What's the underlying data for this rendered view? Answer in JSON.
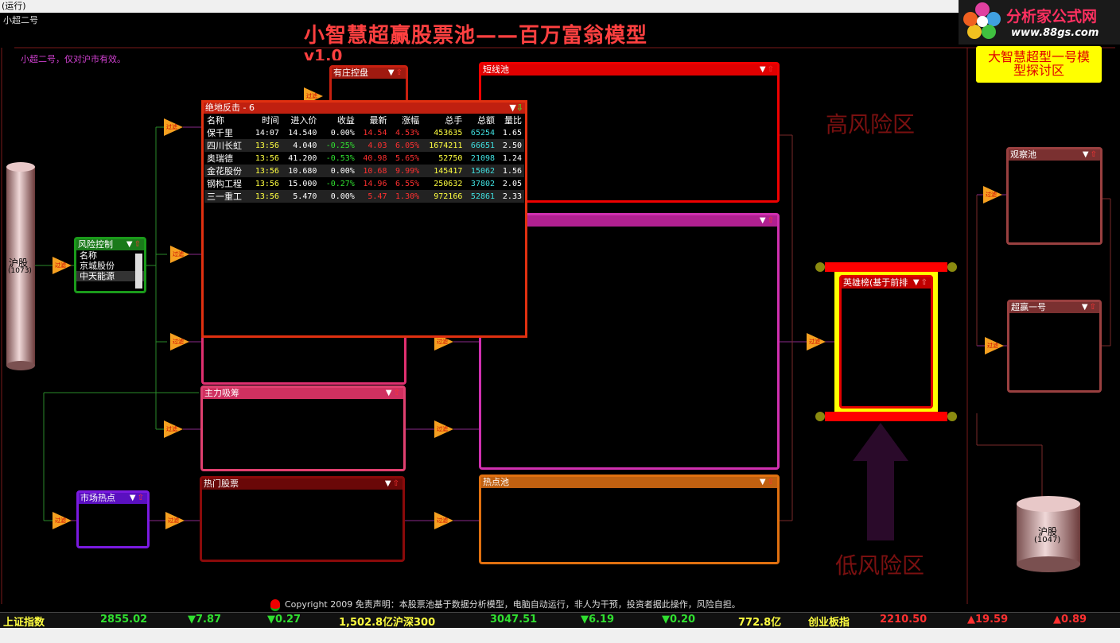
{
  "window": {
    "status": "(运行)",
    "subtitle": "小超二号"
  },
  "title": "小智慧超赢股票池——百万富翁模型",
  "version": "v1.0",
  "note": "小超二号，仅对沪市有效。",
  "logo": {
    "name": "分析家公式网",
    "url": "www.88gs.com"
  },
  "side_box": "大智慧超型一号模型探讨区",
  "risk": {
    "high": "高风险区",
    "low": "低风险区"
  },
  "sources": {
    "left": {
      "name": "沪股",
      "count": "(1073)"
    },
    "right": {
      "name": "沪股",
      "count": "(1047)"
    }
  },
  "node_label": "过滤",
  "pools": {
    "risk_control": {
      "title": "风险控制",
      "col": "名称",
      "items": [
        "京城股份",
        "中天能源"
      ]
    },
    "market_hot": {
      "title": "市场热点"
    },
    "dealer": {
      "title": "有庄控盘"
    },
    "main_absorb": {
      "title": "主力吸筹"
    },
    "hot_stocks": {
      "title": "热门股票"
    },
    "short_pool": {
      "title": "短线池"
    },
    "hotspot_pool": {
      "title": "热点池"
    },
    "heroes": {
      "title": "英雄榜(基于前排"
    },
    "watch": {
      "title": "观察池"
    },
    "super1": {
      "title": "超赢一号"
    }
  },
  "popup": {
    "title": "绝地反击 - 6",
    "columns": [
      "名称",
      "时间",
      "进入价",
      "收益",
      "最新",
      "涨幅",
      "总手",
      "总额",
      "量比"
    ],
    "rows": [
      [
        "保千里",
        "14:07",
        "14.540",
        "0.00%",
        "14.54",
        "4.53%",
        "453635",
        "65254",
        "1.65"
      ],
      [
        "四川长虹",
        "13:56",
        "4.040",
        "-0.25%",
        "4.03",
        "6.05%",
        "1674211",
        "66651",
        "2.50"
      ],
      [
        "奥瑞德",
        "13:56",
        "41.200",
        "-0.53%",
        "40.98",
        "5.65%",
        "52750",
        "21098",
        "1.24"
      ],
      [
        "金花股份",
        "13:56",
        "10.680",
        "0.00%",
        "10.68",
        "9.99%",
        "145417",
        "15062",
        "1.56"
      ],
      [
        "钢构工程",
        "13:56",
        "15.000",
        "-0.27%",
        "14.96",
        "6.55%",
        "250632",
        "37802",
        "2.05"
      ],
      [
        "三一重工",
        "13:56",
        "5.470",
        "0.00%",
        "5.47",
        "1.30%",
        "972166",
        "52861",
        "2.33"
      ]
    ]
  },
  "footer": "Copyright 2009  免责声明：本股票池基于数据分析模型，电脑自动运行，非人为干预，投资者据此操作，风险自担。",
  "ticker": [
    {
      "name": "上证指数",
      "value": "2855.02",
      "change": "▼7.87",
      "pct": "▼0.27",
      "amount": "1,502.8亿"
    },
    {
      "name": "沪深300",
      "value": "3047.51",
      "change": "▼6.19",
      "pct": "▼0.20",
      "amount": "772.8亿"
    },
    {
      "name": "创业板指",
      "value": "2210.50",
      "change": "▲19.59",
      "pct": "▲0.89",
      "amount": ""
    }
  ],
  "colors": {
    "up": "#ff3030",
    "down": "#30e030",
    "accent": "#ffff00"
  }
}
